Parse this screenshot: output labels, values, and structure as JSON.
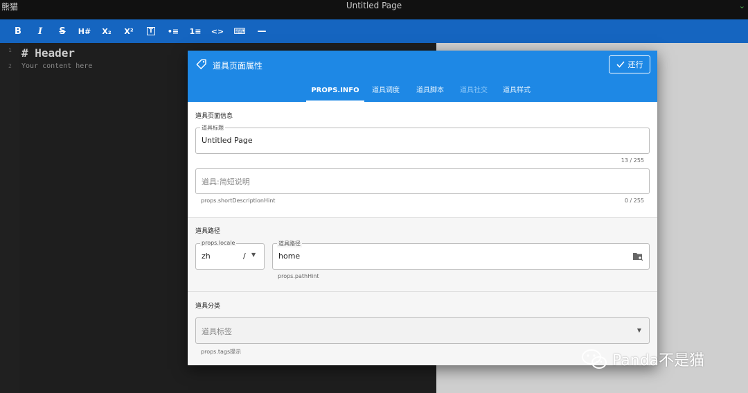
{
  "app": {
    "name": "熊猫",
    "window_title": "Untitled Page"
  },
  "toolbar": {
    "buttons": [
      {
        "label": "B",
        "icon": "bold-icon"
      },
      {
        "label": "I",
        "icon": "italic-icon"
      },
      {
        "label": "S",
        "icon": "strikethrough-icon"
      },
      {
        "label": "H#",
        "icon": "heading-icon"
      },
      {
        "label": "X₂",
        "icon": "subscript-icon"
      },
      {
        "label": "X²",
        "icon": "superscript-icon"
      },
      {
        "label": "T",
        "icon": "text-box-icon"
      },
      {
        "label": "•≡",
        "icon": "bullet-list-icon"
      },
      {
        "label": "1≡",
        "icon": "numbered-list-icon"
      },
      {
        "label": "<>",
        "icon": "code-icon"
      },
      {
        "label": "⌨",
        "icon": "keyboard-icon"
      },
      {
        "label": "—",
        "icon": "horizontal-rule-icon"
      }
    ]
  },
  "editor": {
    "line_numbers": [
      "1",
      "2"
    ],
    "lines": [
      "# Header",
      "Your content here"
    ]
  },
  "modal": {
    "title": "道具页面属性",
    "restore_label": "还行",
    "tabs": [
      {
        "label": "PROPS.INFO",
        "state": "active"
      },
      {
        "label": "道具调度",
        "state": "normal"
      },
      {
        "label": "道具脚本",
        "state": "normal"
      },
      {
        "label": "道具社交",
        "state": "disabled"
      },
      {
        "label": "道具样式",
        "state": "normal"
      }
    ],
    "info": {
      "section_title": "道具页面信息",
      "title_field": {
        "label": "道具标题",
        "value": "Untitled Page",
        "counter": "13 / 255"
      },
      "desc_field": {
        "placeholder": "道具:简短说明",
        "hint": "props.shortDescriptionHint",
        "counter": "0 / 255"
      }
    },
    "path": {
      "section_title": "道具路径",
      "locale_field": {
        "label": "props.locale",
        "value": "zh",
        "separator": "/"
      },
      "path_field": {
        "label": "道具路径",
        "value": "home",
        "hint": "props.pathHint"
      }
    },
    "category": {
      "section_title": "道具分类",
      "tags_field": {
        "placeholder": "道具标签",
        "hint": "props.tags提示"
      }
    }
  },
  "watermark": {
    "text": "Panda不是猫"
  },
  "colors": {
    "toolbar": "#1565c0",
    "modal_header": "#1e88e5"
  }
}
